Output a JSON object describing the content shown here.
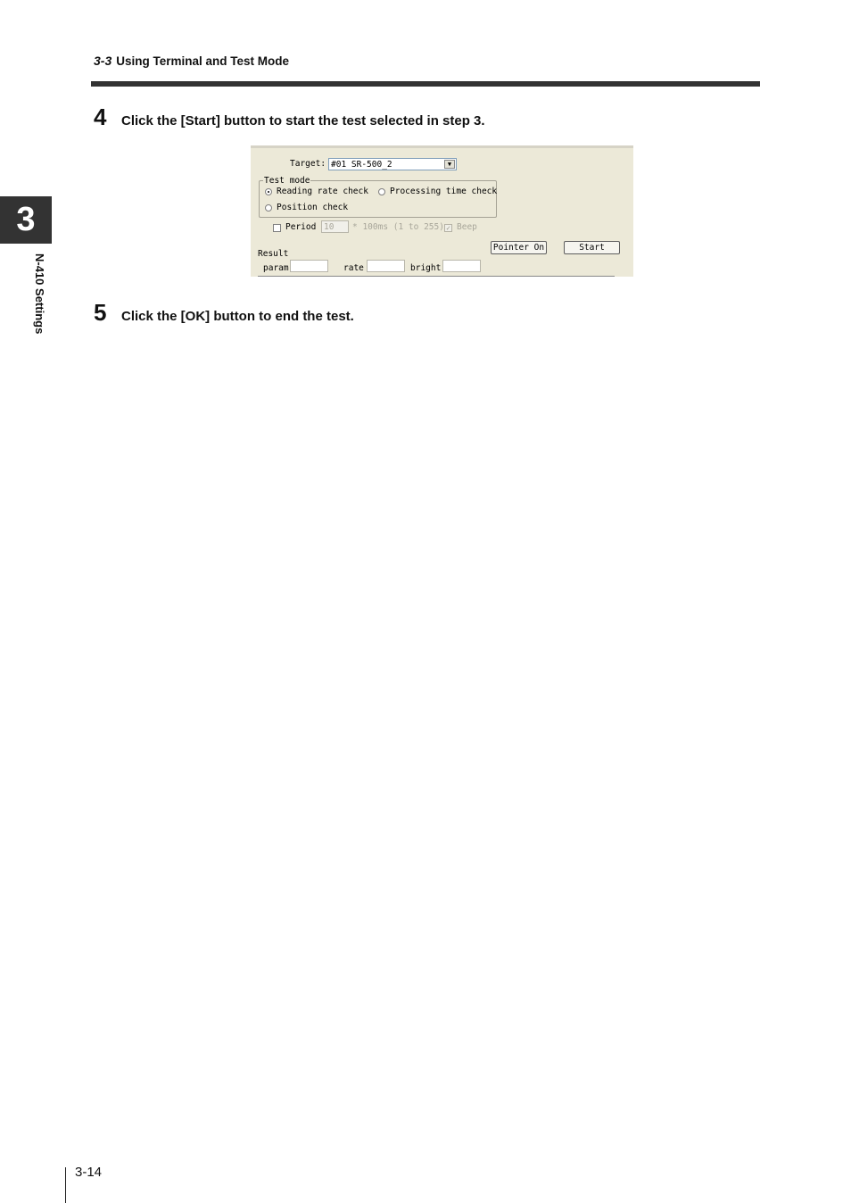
{
  "header": {
    "section": "3-3",
    "title": "Using Terminal and Test Mode"
  },
  "chapter": {
    "number": "3",
    "side_label": "N-410 Settings"
  },
  "steps": [
    {
      "number": "4",
      "text": "Click the [Start] button to start the test selected in step 3."
    },
    {
      "number": "5",
      "text": "Click the [OK] button to end the test."
    }
  ],
  "dialog": {
    "target_label": "Target:",
    "target_value": "#01 SR-500_2",
    "test_mode_label": "Test mode",
    "radio_reading": "Reading rate check",
    "radio_processing": "Processing time check",
    "radio_position": "Position check",
    "selected_mode": "Reading rate check",
    "period_label": "Period",
    "period_value": "10",
    "period_unit": "* 100ms (1 to 255)",
    "beep_label": "Beep",
    "result_label": "Result",
    "param_label": "param",
    "rate_label": "rate",
    "bright_label": "bright",
    "pointer_button": "Pointer On",
    "start_button": "Start"
  },
  "footer": {
    "page": "3-14"
  }
}
